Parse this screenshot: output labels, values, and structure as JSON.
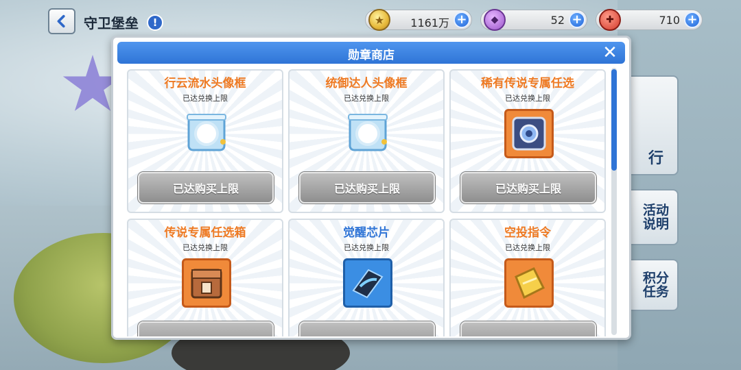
{
  "header": {
    "title": "守卫堡垒",
    "info_icon": "info-icon"
  },
  "resources": [
    {
      "icon": "gold-coin-icon",
      "value": "1161万"
    },
    {
      "icon": "purple-gem-icon",
      "value": "52"
    },
    {
      "icon": "red-tool-icon",
      "value": "710"
    }
  ],
  "side_buttons": {
    "b1": "行",
    "b2": "活动说明",
    "b3": "积分任务"
  },
  "dialog": {
    "title": "勋章商店",
    "close_icon": "close-icon"
  },
  "items": [
    {
      "name": "行云流水头像框",
      "sub": "已达兑换上限",
      "button": "已达购买上限",
      "title_color": "#ee7a23",
      "icon": "avatar-frame-icon"
    },
    {
      "name": "统御达人头像框",
      "sub": "已达兑换上限",
      "button": "已达购买上限",
      "title_color": "#ee7a23",
      "icon": "avatar-frame-icon"
    },
    {
      "name": "稀有传说专属任选",
      "sub": "已达兑换上限",
      "button": "已达购买上限",
      "title_color": "#ee7a23",
      "icon": "legendary-box-icon"
    },
    {
      "name": "传说专属任选箱",
      "sub": "已达兑换上限",
      "button": "",
      "title_color": "#ee7a23",
      "icon": "chest-icon"
    },
    {
      "name": "觉醒芯片",
      "sub": "已达兑换上限",
      "button": "",
      "title_color": "#2f74d6",
      "icon": "chip-icon"
    },
    {
      "name": "空投指令",
      "sub": "已达兑换上限",
      "button": "",
      "title_color": "#ee7a23",
      "icon": "airdrop-card-icon"
    }
  ]
}
